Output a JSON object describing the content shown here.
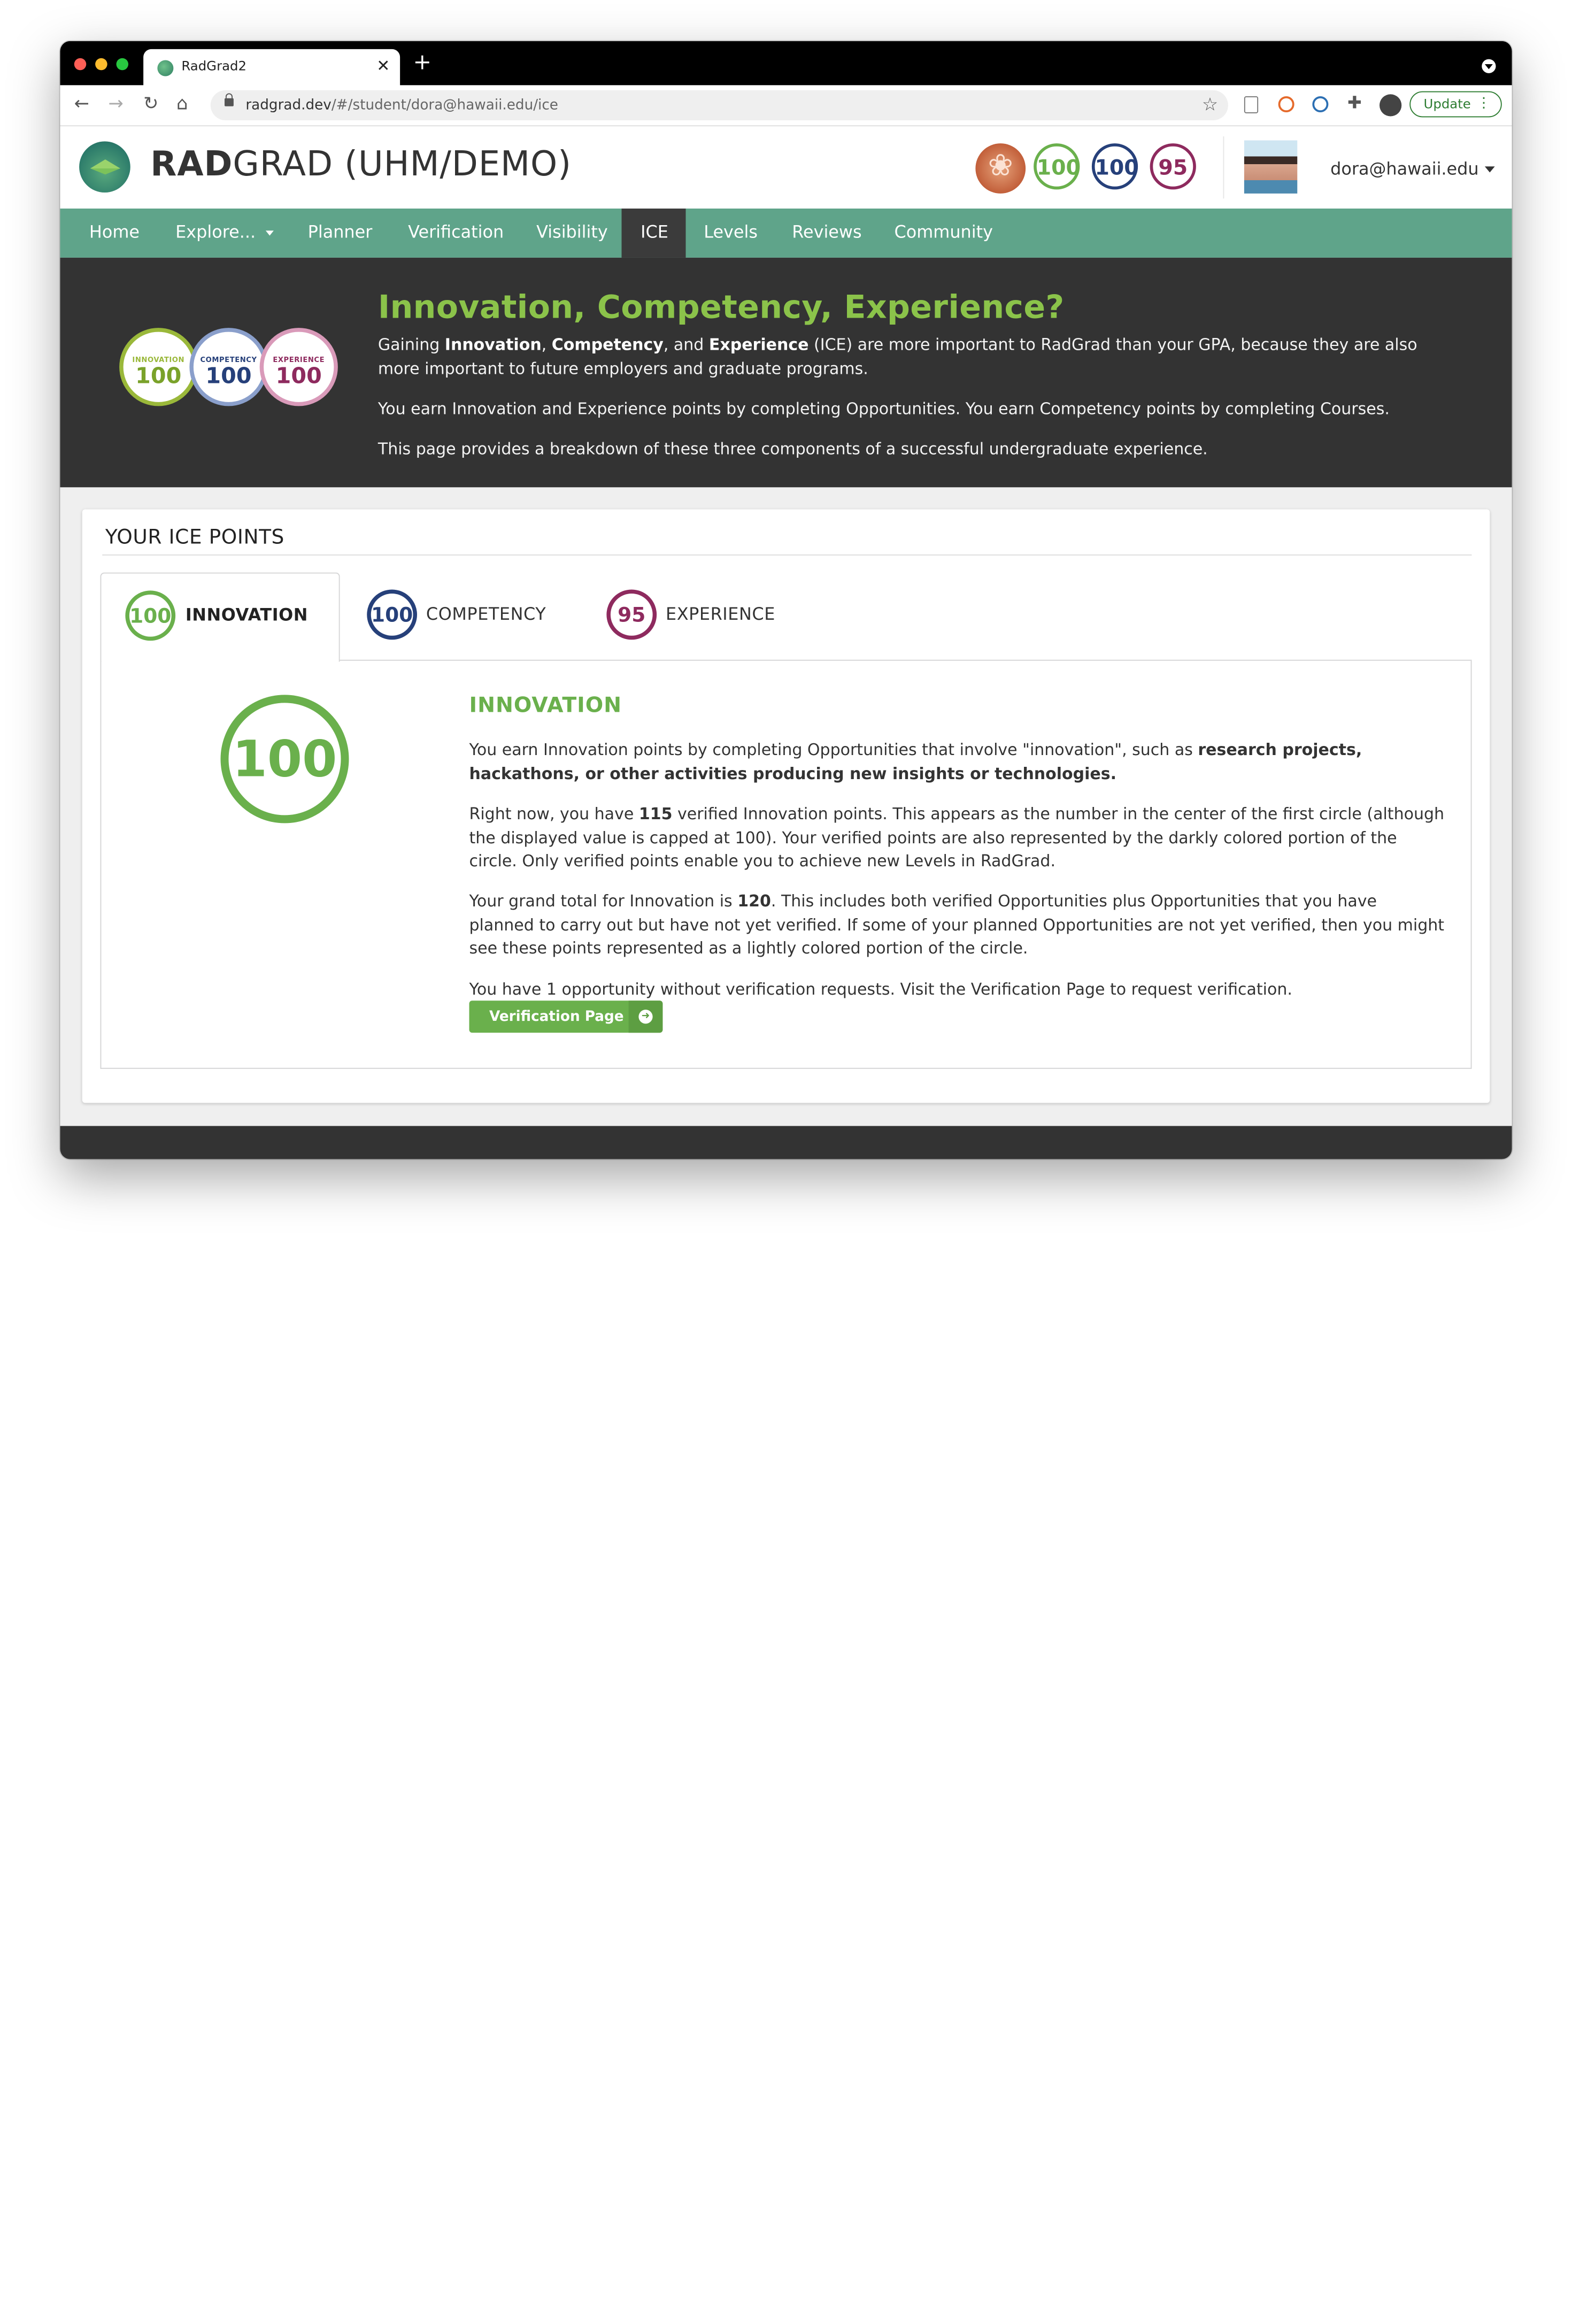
{
  "browser": {
    "tab_title": "RadGrad2",
    "url_host": "radgrad.dev",
    "url_path": "/#/student/dora@hawaii.edu/ice",
    "update_label": "Update"
  },
  "header": {
    "brand_bold": "RAD",
    "brand_rest": "GRAD (UHM/DEMO)",
    "badges": {
      "innovation": "100",
      "competency": "100",
      "experience": "95"
    },
    "user_email": "dora@hawaii.edu"
  },
  "nav": [
    "Home",
    "Explore...",
    "Planner",
    "Verification",
    "Visibility",
    "ICE",
    "Levels",
    "Reviews",
    "Community"
  ],
  "nav_active": "ICE",
  "hero": {
    "title": "Innovation, Competency, Experience?",
    "badges": [
      {
        "label": "INNOVATION",
        "value": "100"
      },
      {
        "label": "COMPETENCY",
        "value": "100"
      },
      {
        "label": "EXPERIENCE",
        "value": "100"
      }
    ],
    "p1_a": "Gaining ",
    "p1_innovation": "Innovation",
    "p1_b": ", ",
    "p1_competency": "Competency",
    "p1_c": ", and ",
    "p1_experience": "Experience",
    "p1_d": " (ICE) are more important to RadGrad than your GPA, because they are also more important to future employers and graduate programs.",
    "p2": "You earn Innovation and Experience points by completing Opportunities. You earn Competency points by completing Courses.",
    "p3": "This page provides a breakdown of these three components of a successful undergraduate experience."
  },
  "ice_points": {
    "title": "YOUR ICE POINTS",
    "tabs": [
      {
        "value": "100",
        "label": "INNOVATION"
      },
      {
        "value": "100",
        "label": "COMPETENCY"
      },
      {
        "value": "95",
        "label": "EXPERIENCE"
      }
    ],
    "active_tab": "INNOVATION",
    "big_value": "100",
    "section_title": "INNOVATION",
    "p1_a": "You earn Innovation points by completing Opportunities that involve \"innovation\", such as ",
    "p1_bold": "research projects, hackathons, or other activities producing new insights or technologies.",
    "p2_a": "Right now, you have ",
    "p2_num": "115",
    "p2_b": " verified Innovation points. This appears as the number in the center of the first circle (although the displayed value is capped at 100). Your verified points are also represented by the darkly colored portion of the circle. Only verified points enable you to achieve new Levels in RadGrad.",
    "p3_a": "Your grand total for Innovation is ",
    "p3_num": "120",
    "p3_b": ". This includes both verified Opportunities plus Opportunities that you have planned to carry out but have not yet verified. If some of your planned Opportunities are not yet verified, then you might see these points represented as a lightly colored portion of the circle.",
    "p4": "You have 1 opportunity without verification requests. Visit the Verification Page to request verification.",
    "button_label": "Verification Page"
  },
  "colors": {
    "innovation": "#6ab04c",
    "competency": "#26407a",
    "experience": "#8e2a5e",
    "nav_bg": "#5fa48a",
    "hero_bg": "#333333"
  }
}
